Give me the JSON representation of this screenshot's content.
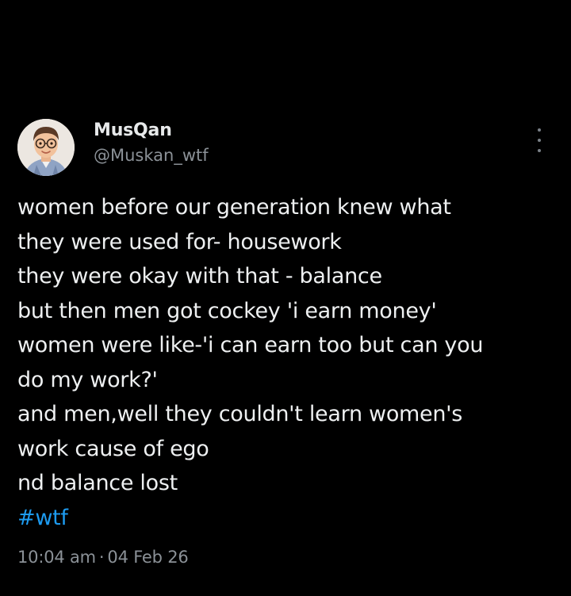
{
  "author": {
    "display_name": "MusQan",
    "handle": "@Muskan_wtf",
    "avatar_icon": "memoji-avatar-icon"
  },
  "menu": {
    "icon": "more-options-icon"
  },
  "tweet": {
    "lines": [
      "women before our generation knew what",
      "they were used for- housework",
      "they were okay with that - balance",
      "but then men got cockey 'i earn money'",
      "women were like-'i can earn too but can you",
      "do my work?'",
      "and men,well they couldn't learn women's",
      "work cause of ego",
      "nd balance lost"
    ],
    "hashtag": "#wtf"
  },
  "meta": {
    "time": "10:04 am",
    "separator": "·",
    "date": "04 Feb 26"
  },
  "colors": {
    "background": "#000000",
    "text": "#e7e9ea",
    "secondary": "#8b9197",
    "accent": "#1d9bf0"
  }
}
